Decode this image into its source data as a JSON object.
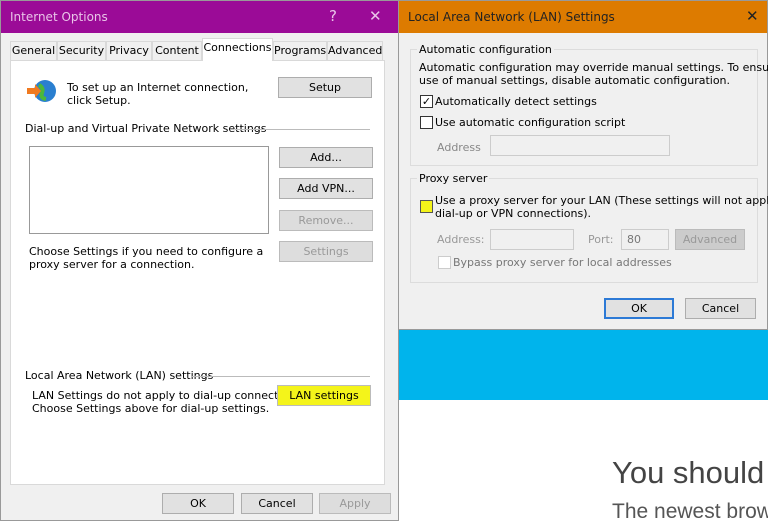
{
  "background": {
    "headline": "You should",
    "subline": "The newest brow",
    "band_color": "#00b4ec"
  },
  "internet_options": {
    "title": "Internet Options",
    "help": "?",
    "close": "✕",
    "title_color": "#9b0b97",
    "tabs": [
      {
        "label": "General"
      },
      {
        "label": "Security"
      },
      {
        "label": "Privacy"
      },
      {
        "label": "Content"
      },
      {
        "label": "Connections"
      },
      {
        "label": "Programs"
      },
      {
        "label": "Advanced"
      }
    ],
    "active_tab": "Connections",
    "setup_text": "To set up an Internet connection, click Setup.",
    "setup_button": "Setup",
    "dialup_heading": "Dial-up and Virtual Private Network settings",
    "add_button": "Add...",
    "add_vpn_button": "Add VPN...",
    "remove_button": "Remove...",
    "settings_button": "Settings",
    "proxy_note": "Choose Settings if you need to configure a proxy server for a connection.",
    "lan_heading": "Local Area Network (LAN) settings",
    "lan_note_1": "LAN Settings do not apply to dial-up connections.",
    "lan_note_2": "Choose Settings above for dial-up settings.",
    "lan_button": "LAN settings",
    "highlight_color": "#f4f41a",
    "ok": "OK",
    "cancel": "Cancel",
    "apply": "Apply"
  },
  "lan_dialog": {
    "title": "Local Area Network (LAN) Settings",
    "close": "✕",
    "title_color": "#dd7b00",
    "auto_heading": "Automatic configuration",
    "auto_desc_1": "Automatic configuration may override manual settings.  To ensure the",
    "auto_desc_2": "use of manual settings, disable automatic configuration.",
    "auto_detect_label": "Automatically detect settings",
    "auto_detect_checked": true,
    "auto_script_label": "Use automatic configuration script",
    "auto_script_checked": false,
    "address_label": "Address",
    "address_value": "",
    "proxy_heading": "Proxy server",
    "proxy_label_1": "Use a proxy server for your LAN (These settings will not apply to",
    "proxy_label_2": "dial-up or VPN connections).",
    "proxy_checked": false,
    "proxy_address_label": "Address:",
    "proxy_address_value": "",
    "port_label": "Port:",
    "port_value": "80",
    "advanced_button": "Advanced",
    "bypass_label": "Bypass proxy server for local addresses",
    "bypass_checked": false,
    "ok": "OK",
    "cancel": "Cancel"
  }
}
